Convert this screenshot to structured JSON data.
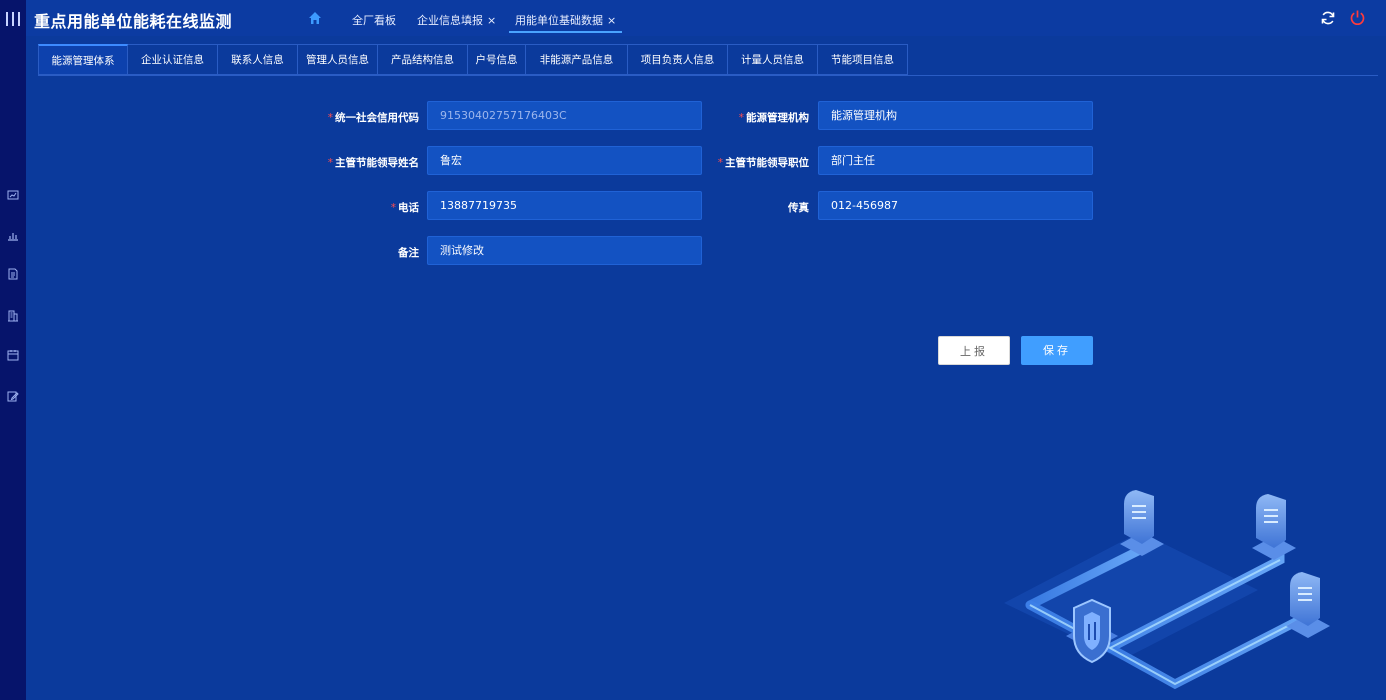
{
  "app": {
    "title": "重点用能单位能耗在线监测"
  },
  "icons": {
    "menu": "menu-bars-icon",
    "home": "home-icon",
    "refresh": "refresh-icon",
    "power": "power-icon",
    "rail": [
      "chart-card-icon",
      "bar-chart-icon",
      "document-icon",
      "building-icon",
      "calendar-icon",
      "edit-icon"
    ]
  },
  "colors": {
    "accent": "#409eff",
    "required": "#ff4d4f",
    "power": "#ff3b3b",
    "background": "#0b3a9c"
  },
  "top_tabs": [
    {
      "label": "全厂看板",
      "closable": false
    },
    {
      "label": "企业信息填报",
      "closable": true,
      "close": "×"
    },
    {
      "label": "用能单位基础数据",
      "closable": true,
      "close": "×",
      "active": true
    }
  ],
  "sub_tabs": [
    {
      "label": "能源管理体系",
      "active": true
    },
    {
      "label": "企业认证信息"
    },
    {
      "label": "联系人信息"
    },
    {
      "label": "管理人员信息"
    },
    {
      "label": "产品结构信息"
    },
    {
      "label": "户号信息"
    },
    {
      "label": "非能源产品信息"
    },
    {
      "label": "项目负责人信息"
    },
    {
      "label": "计量人员信息"
    },
    {
      "label": "节能项目信息"
    }
  ],
  "form": {
    "required_mark": "*",
    "credit_code": {
      "label": "统一社会信用代码",
      "value": "91530402757176403C",
      "required": true
    },
    "org": {
      "label": "能源管理机构",
      "value": "能源管理机构",
      "required": true
    },
    "leader_name": {
      "label": "主管节能领导姓名",
      "value": "鲁宏",
      "required": true
    },
    "leader_title": {
      "label": "主管节能领导职位",
      "value": "部门主任",
      "required": true
    },
    "phone": {
      "label": "电话",
      "value": "13887719735",
      "required": true
    },
    "fax": {
      "label": "传真",
      "value": "012-456987",
      "required": false
    },
    "remark": {
      "label": "备注",
      "value": "测试修改",
      "required": false
    }
  },
  "buttons": {
    "report": "上报",
    "save": "保存"
  }
}
